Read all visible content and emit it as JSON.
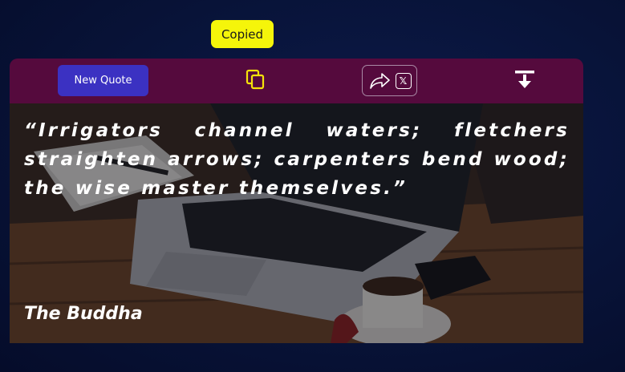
{
  "tooltip": {
    "text": "Copied"
  },
  "toolbar": {
    "new_quote_label": "New Quote",
    "copy_icon": "copy-icon",
    "share_icon": "share-arrow-icon",
    "x_icon_label": "𝕏",
    "download_icon": "download-icon"
  },
  "quote": {
    "text": "“Irrigators channel waters; fletchers straighten arrows; carpenters bend wood; the wise master themselves.”",
    "author": "The Buddha"
  },
  "colors": {
    "page_background": "#081338",
    "toolbar": "#550a3d",
    "new_quote_button": "#3b31c2",
    "tooltip": "#f5f50a",
    "copy_icon": "#f5e20a"
  }
}
